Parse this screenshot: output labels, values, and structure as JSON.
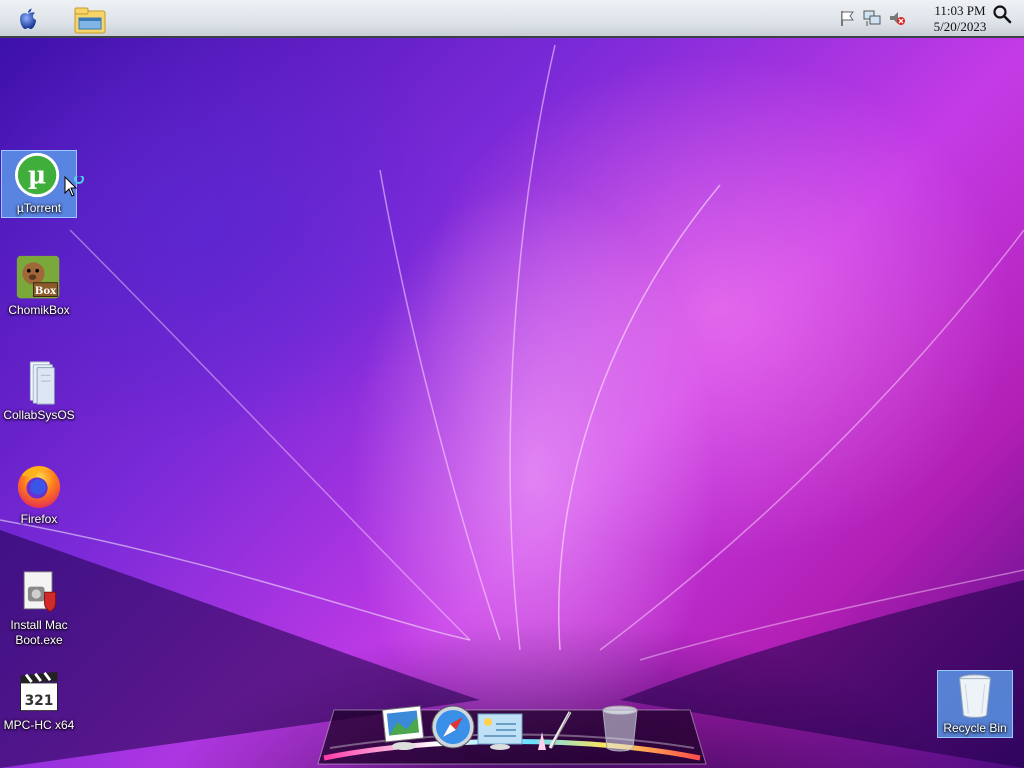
{
  "menubar": {
    "clock_time": "11:03 PM",
    "clock_date": "5/20/2023",
    "icons": [
      "apple-icon",
      "file-explorer-icon",
      "flag-icon",
      "network-icon",
      "volume-muted-icon",
      "search-icon"
    ]
  },
  "desktop_icons": [
    {
      "label": "µTorrent",
      "icon": "utorrent-icon",
      "selected": true
    },
    {
      "label": "ChomikBox",
      "icon": "chomikbox-icon",
      "badge": "Box"
    },
    {
      "label": "CollabSysOS",
      "icon": "folder-icon"
    },
    {
      "label": "Firefox",
      "icon": "firefox-icon"
    },
    {
      "label": "Install Mac Boot.exe",
      "label_line1": "Install Mac",
      "label_line2": "Boot.exe",
      "icon": "installer-icon"
    },
    {
      "label": "MPC-HC x64",
      "icon": "mpc-hc-icon",
      "badge": "321"
    }
  ],
  "recycle_bin": {
    "label": "Recycle Bin",
    "icon": "recycle-bin-icon"
  },
  "dock": {
    "items": [
      "preview-icon",
      "safari-icon",
      "mail-icon",
      "brush-icon",
      "trash-icon"
    ]
  },
  "colors": {
    "wallpaper_dark": "#3a0fa8",
    "wallpaper_pink": "#e040e8",
    "selection": "#5a96e6",
    "menubar": "#dfe4ea"
  }
}
